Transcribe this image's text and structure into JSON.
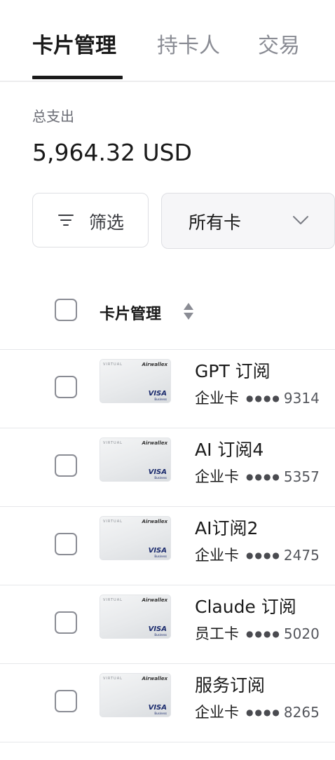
{
  "tabs": [
    {
      "label": "卡片管理",
      "active": true
    },
    {
      "label": "持卡人",
      "active": false
    },
    {
      "label": "交易",
      "active": false
    }
  ],
  "summary": {
    "total_label": "总支出",
    "total_amount": "5,964.32",
    "currency": "USD"
  },
  "filters": {
    "filter_label": "筛选",
    "card_select_value": "所有卡"
  },
  "table": {
    "header_label": "卡片管理"
  },
  "card_thumbnail": {
    "virtual_text": "VIRTUAL",
    "brand_text": "Airwallex",
    "network_text": "VISA",
    "network_sub_text": "Business"
  },
  "cards": [
    {
      "name": "GPT 订阅",
      "type": "企业卡",
      "dots": "●●●●",
      "last4": "9314"
    },
    {
      "name": "AI 订阅4",
      "type": "企业卡",
      "dots": "●●●●",
      "last4": "5357"
    },
    {
      "name": "AI订阅2",
      "type": "企业卡",
      "dots": "●●●●",
      "last4": "2475"
    },
    {
      "name": "Claude 订阅",
      "type": "员工卡",
      "dots": "●●●●",
      "last4": "5020"
    },
    {
      "name": "服务订阅",
      "type": "企业卡",
      "dots": "●●●●",
      "last4": "8265"
    }
  ],
  "colors": {
    "text_primary": "#1a1a1a",
    "text_muted": "#8a8c94",
    "border": "#dedfe3",
    "visa_blue": "#1a2a6c"
  }
}
